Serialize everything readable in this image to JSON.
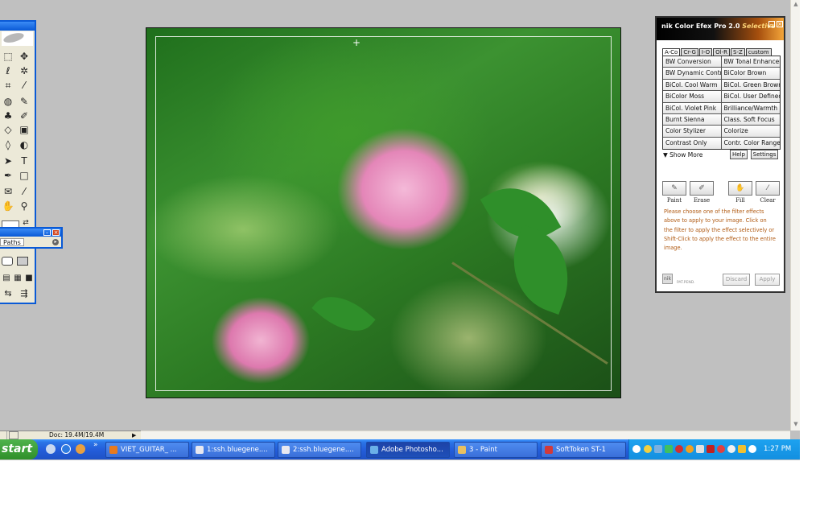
{
  "photoshop": {
    "paths_tab": "Paths",
    "status_doc": "Doc: 19.4M/19.4M"
  },
  "nik": {
    "title": "nik Color Efex Pro 2.0",
    "title_mode": "Selective",
    "tabs": [
      "A-Co",
      "Cr-G",
      "I-O",
      "Ol-R",
      "S-Z",
      "custom"
    ],
    "filters": [
      [
        "BW Conversion",
        "BW Tonal Enhancer"
      ],
      [
        "BW Dynamic Contr.",
        "BiColor Brown"
      ],
      [
        "BiCol. Cool Warm",
        "BiCol. Green Brown"
      ],
      [
        "BiColor Moss",
        "BiCol. User Defined"
      ],
      [
        "BiCol. Violet Pink",
        "Brilliance/Warmth"
      ],
      [
        "Burnt Sienna",
        "Class. Soft Focus"
      ],
      [
        "Color Stylizer",
        "Colorize"
      ],
      [
        "Contrast Only",
        "Contr. Color Range"
      ]
    ],
    "show_more": "Show More",
    "help": "Help",
    "settings": "Settings",
    "brushes": [
      "Paint",
      "Erase",
      "Fill",
      "Clear"
    ],
    "instructions": "Please choose one of the filter effects above to apply to your image. Click on the filter to apply the effect selectively or Shift-Click to apply the effect to the entire image.",
    "logo": "nik",
    "pat_pend": "PAT.PEND.",
    "discard": "Discard",
    "apply": "Apply"
  },
  "taskbar": {
    "start": "start",
    "tasks": [
      {
        "label": "VIET_GUITAR_ ...",
        "color": "#e87a1e"
      },
      {
        "label": "1:ssh.bluegene....",
        "color": "#e8e8f0"
      },
      {
        "label": "2:ssh.bluegene....",
        "color": "#e8e8f0"
      },
      {
        "label": "Adobe Photosho...",
        "color": "#6ab0e8"
      },
      {
        "label": "3 - Paint",
        "color": "#e8c060"
      },
      {
        "label": "SoftToken ST-1",
        "color": "#d23a3a"
      }
    ],
    "clock": "1:27 PM"
  }
}
